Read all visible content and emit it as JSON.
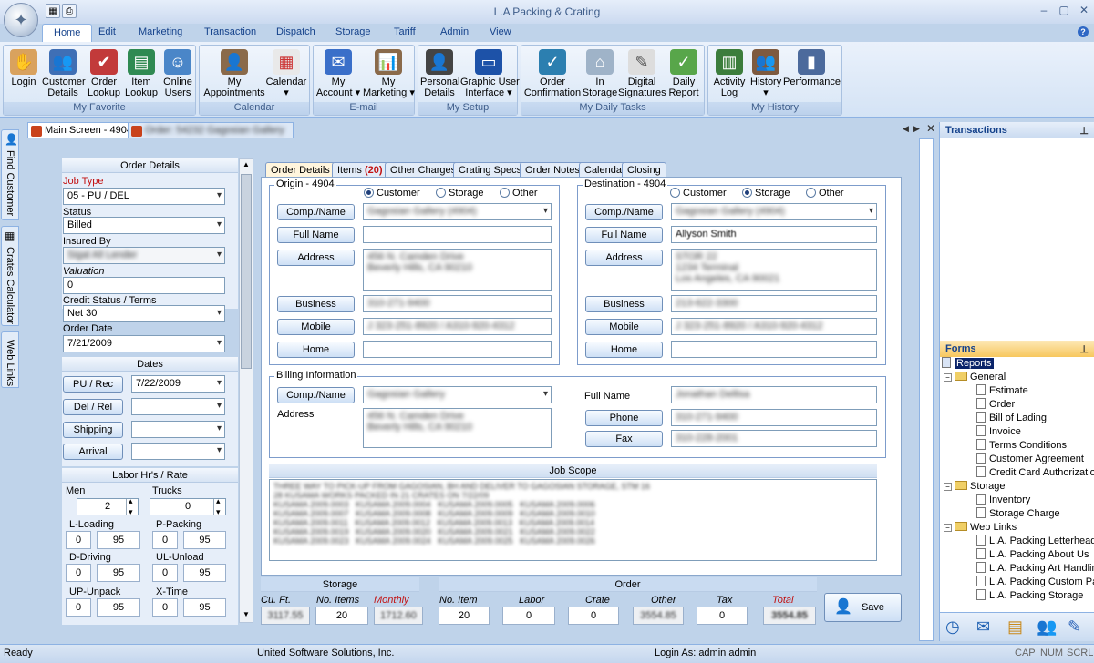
{
  "app": {
    "title": "L.A Packing & Crating"
  },
  "menu": [
    "Home",
    "Edit",
    "Marketing",
    "Transaction",
    "Dispatch",
    "Storage",
    "Tariff",
    "Admin",
    "View"
  ],
  "ribbon": {
    "groups": [
      {
        "title": "My Favorite",
        "buttons": [
          {
            "label": "Login",
            "icon": "login-icon"
          },
          {
            "label": "Customer\nDetails",
            "icon": "customer-icon"
          },
          {
            "label": "Order\nLookup",
            "icon": "order-lookup-icon"
          },
          {
            "label": "Item\nLookup",
            "icon": "item-lookup-icon"
          },
          {
            "label": "Online\nUsers",
            "icon": "online-users-icon"
          }
        ]
      },
      {
        "title": "Calendar",
        "buttons": [
          {
            "label": "My\nAppointments",
            "icon": "appointments-icon"
          },
          {
            "label": "Calendar\n▾",
            "icon": "calendar-icon"
          }
        ]
      },
      {
        "title": "E-mail",
        "buttons": [
          {
            "label": "My\nAccount ▾",
            "icon": "mail-icon"
          },
          {
            "label": "My\nMarketing ▾",
            "icon": "marketing-icon"
          }
        ]
      },
      {
        "title": "My Setup",
        "buttons": [
          {
            "label": "Personal\nDetails",
            "icon": "personal-icon"
          },
          {
            "label": "Graphic User\nInterface ▾",
            "icon": "monitor-icon"
          }
        ]
      },
      {
        "title": "My Daily Tasks",
        "buttons": [
          {
            "label": "Order\nConfirmation",
            "icon": "confirm-icon"
          },
          {
            "label": "In\nStorage",
            "icon": "storage-icon"
          },
          {
            "label": "Digital\nSignatures",
            "icon": "signature-icon"
          },
          {
            "label": "Daily\nReport",
            "icon": "report-icon"
          }
        ]
      },
      {
        "title": "My History",
        "buttons": [
          {
            "label": "Activity\nLog",
            "icon": "activity-icon"
          },
          {
            "label": "History\n▾",
            "icon": "history-icon"
          },
          {
            "label": "Performance",
            "icon": "performance-icon"
          }
        ]
      }
    ]
  },
  "doc_tabs": {
    "main": "Main Screen - 4904",
    "order": "Order: 54232 Gagosian Gallery"
  },
  "side_tabs": [
    "Find Customer",
    "Crates Calculator",
    "Web Links"
  ],
  "order_details": {
    "header": "Order Details",
    "job_type_label": "Job Type",
    "job_type": "05 - PU / DEL",
    "status_label": "Status",
    "status": "Billed",
    "insured_label": "Insured By",
    "insured": "Sigal All Lender",
    "valuation_label": "Valuation",
    "valuation": "0",
    "credit_label": "Credit Status / Terms",
    "credit": "Net 30",
    "order_date_label": "Order Date",
    "order_date": "7/21/2009"
  },
  "dates": {
    "header": "Dates",
    "pu_label": "PU / Rec",
    "pu_value": "7/22/2009",
    "del_label": "Del / Rel",
    "shipping_label": "Shipping",
    "arrival_label": "Arrival"
  },
  "labor": {
    "header": "Labor Hr's / Rate",
    "men_label": "Men",
    "men": "2",
    "trucks_label": "Trucks",
    "trucks": "0",
    "rows": [
      {
        "l1": "L-Loading",
        "a": "0",
        "b": "95",
        "l2": "P-Packing",
        "c": "0",
        "d": "95"
      },
      {
        "l1": "D-Driving",
        "a": "0",
        "b": "95",
        "l2": "UL-Unload",
        "c": "0",
        "d": "95"
      },
      {
        "l1": "UP-Unpack",
        "a": "0",
        "b": "95",
        "l2": "X-Time",
        "c": "0",
        "d": "95"
      }
    ]
  },
  "content_tabs": [
    "Order Details",
    "Items (20)",
    "Other Charges",
    "Crating Specs",
    "Order Notes",
    "Calendar",
    "Closing"
  ],
  "origin": {
    "legend": "Origin - 4904",
    "radio": [
      "Customer",
      "Storage",
      "Other"
    ],
    "comp_label": "Comp./Name",
    "comp": "Gagosian Gallery (4904)",
    "fullname_label": "Full Name",
    "fullname": "",
    "address_label": "Address",
    "address": "456 N. Camden Drive\nBeverly Hills, CA 90210",
    "business_label": "Business",
    "business": "310-271-9400",
    "mobile_label": "Mobile",
    "mobile": "J 323-251-8920 / A310-920-4312",
    "home_label": "Home",
    "home": ""
  },
  "destination": {
    "legend": "Destination - 4904",
    "radio": [
      "Customer",
      "Storage",
      "Other"
    ],
    "comp_label": "Comp./Name",
    "comp": "Gagosian Gallery (4904)",
    "fullname_label": "Full Name",
    "fullname": "Allyson Smith",
    "address_label": "Address",
    "address": "STOR 22\n1234 Terminal\nLos Angeles, CA 90021",
    "business_label": "Business",
    "business": "213-622-3300",
    "mobile_label": "Mobile",
    "mobile": "J 323-251-8920 / A310-920-4312",
    "home_label": "Home",
    "home": ""
  },
  "billing": {
    "legend": "Billing Information",
    "comp_label": "Comp./Name",
    "comp": "Gagosian Gallery",
    "address_label": "Address",
    "address": "456 N. Camden Drive\nBeverly Hills, CA 90210",
    "fullname_label": "Full Name",
    "fullname": "Jonathan Dellisa",
    "phone_label": "Phone",
    "phone": "310-271-9400",
    "fax_label": "Fax",
    "fax": "310-228-2001"
  },
  "job_scope": {
    "header": "Job Scope",
    "text": "THREE WAY TO PICK-UP FROM GAGOSIAN, BH AND DELIVER TO GAGOSIAN STORAGE, STM 16\n28 KUSAMA WORKS PACKED IN 21 CRATES ON 7/22/09\nKUSAMA 2009.0003   KUSAMA 2009.0004   KUSAMA 2009.0005   KUSAMA 2009.0006\nKUSAMA 2009.0007   KUSAMA 2009.0008   KUSAMA 2009.0009   KUSAMA 2009.0010\nKUSAMA 2009.0011   KUSAMA 2009.0012   KUSAMA 2009.0013   KUSAMA 2009.0014\nKUSAMA 2009.0019   KUSAMA 2009.0020   KUSAMA 2009.0021   KUSAMA 2009.0022\nKUSAMA 2009.0023   KUSAMA 2009.0024   KUSAMA 2009.0025   KUSAMA 2009.0026"
  },
  "storage": {
    "header": "Storage",
    "cuft_label": "Cu. Ft.",
    "cuft": "3117.55",
    "items_label": "No. Items",
    "items": "20",
    "monthly_label": "Monthly",
    "monthly": "1712.60"
  },
  "order_totals": {
    "header": "Order",
    "noitem_label": "No. Item",
    "noitem": "20",
    "labor_label": "Labor",
    "labor": "0",
    "crate_label": "Crate",
    "crate": "0",
    "other_label": "Other",
    "other": "3554.85",
    "tax_label": "Tax",
    "tax": "0",
    "total_label": "Total",
    "total": "3554.85"
  },
  "save_label": "Save",
  "transactions_header": "Transactions",
  "forms": {
    "header": "Forms",
    "root": "Reports",
    "general": "General",
    "general_items": [
      "Estimate",
      "Order",
      "Bill of Lading",
      "Invoice",
      "Terms Conditions",
      "Customer Agreement",
      "Credit Card Authorization"
    ],
    "storage": "Storage",
    "storage_items": [
      "Inventory",
      "Storage Charge"
    ],
    "weblinks": "Web Links",
    "weblinks_items": [
      "L.A. Packing Letterhead",
      "L.A. Packing About Us",
      "L.A. Packing Art Handling",
      "L.A. Packing Custom Packing",
      "L.A. Packing Storage"
    ]
  },
  "status": {
    "left": "Ready",
    "company": "United Software Solutions, Inc.",
    "login": "Login As: admin admin",
    "caps": [
      "CAP",
      "NUM",
      "SCRL"
    ]
  },
  "colors": {
    "ribbon_accent": "#15428b",
    "tab_highlight": "#fff5dd",
    "required_label": "#c21010"
  }
}
